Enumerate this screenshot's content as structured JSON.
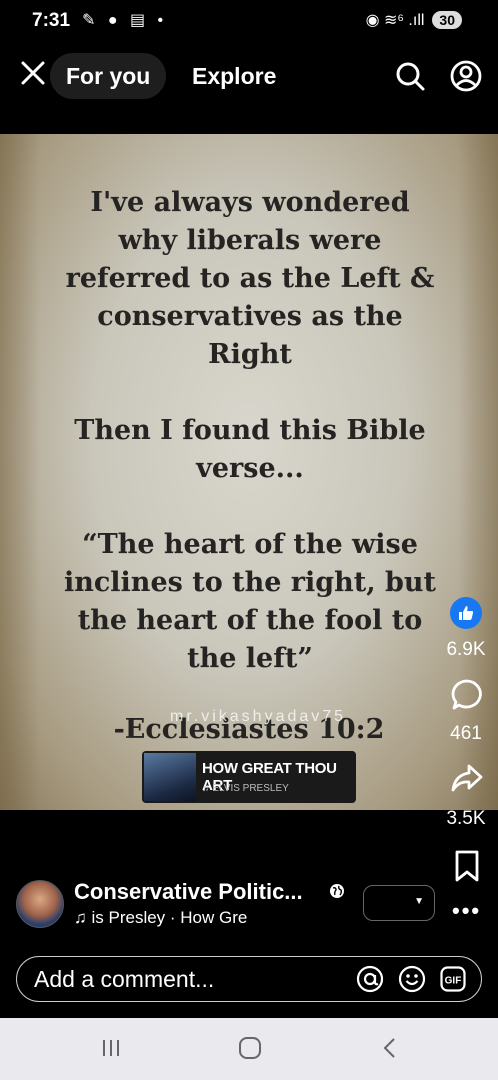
{
  "status_bar": {
    "time": "7:31",
    "left_icons": "✎ ● ▤ •",
    "signal": "◉ ≋⁶ .ıll",
    "battery": "30"
  },
  "nav": {
    "close_icon": "close-icon",
    "tab_for_you": "For you",
    "tab_explore": "Explore"
  },
  "post": {
    "paragraphs": [
      "I've always wondered why liberals were referred to as the Left & conservatives as the Right",
      "Then I found this Bible verse...",
      "“The heart of the wise inclines to the right, but the heart of the fool to the left”"
    ],
    "verse_ref": "-Ecclesiastes 10:2",
    "watermark": "mr.vikashyadav75",
    "music": {
      "title": "HOW GREAT THOU ART",
      "artist": "ELVIS PRESLEY"
    }
  },
  "actions": {
    "likes": "6.9K",
    "comments": "461",
    "shares": "3.5K"
  },
  "author": {
    "name": "Conservative Politic...",
    "song_line": "is Presley · How Gre"
  },
  "comment": {
    "placeholder": "Add a comment..."
  },
  "colors": {
    "accent": "#1877f2",
    "background": "#000000"
  }
}
